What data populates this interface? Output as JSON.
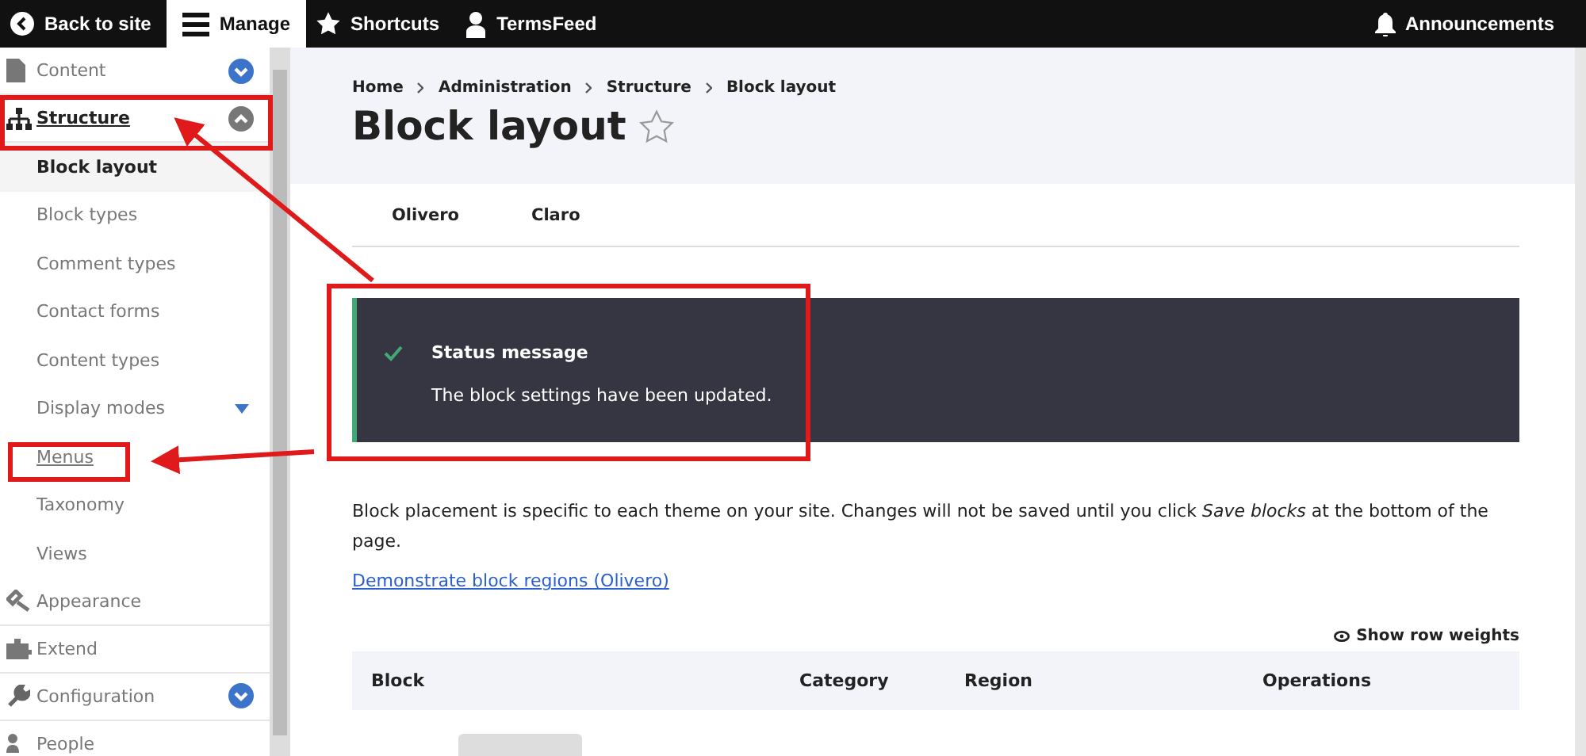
{
  "toolbar": {
    "items": [
      {
        "label": "Back to site",
        "selected": false
      },
      {
        "label": "Manage",
        "selected": true
      },
      {
        "label": "Shortcuts",
        "selected": false
      },
      {
        "label": "TermsFeed",
        "selected": false
      }
    ],
    "announcements": "Announcements"
  },
  "sidebar": {
    "items": [
      {
        "label": "Content",
        "expanded": false
      },
      {
        "label": "Structure",
        "expanded": true,
        "children": [
          {
            "label": "Block layout",
            "selected": true,
            "underlined": false
          },
          {
            "label": "Block types",
            "selected": false,
            "underlined": false
          },
          {
            "label": "Comment types",
            "selected": false,
            "underlined": false
          },
          {
            "label": "Contact forms",
            "selected": false,
            "underlined": false
          },
          {
            "label": "Content types",
            "selected": false,
            "underlined": false
          },
          {
            "label": "Display modes",
            "selected": false,
            "underlined": false,
            "expanded": false
          },
          {
            "label": "Menus",
            "selected": false,
            "underlined": true
          },
          {
            "label": "Taxonomy",
            "selected": false,
            "underlined": false
          },
          {
            "label": "Views",
            "selected": false,
            "underlined": false
          }
        ]
      },
      {
        "label": "Appearance"
      },
      {
        "label": "Extend"
      },
      {
        "label": "Configuration",
        "expanded": false
      },
      {
        "label": "People"
      }
    ]
  },
  "breadcrumb": [
    "Home",
    "Administration",
    "Structure",
    "Block layout"
  ],
  "title": "Block layout",
  "favorite": false,
  "theme_tabs": [
    {
      "label": "Olivero",
      "selected": false
    },
    {
      "label": "Claro",
      "selected": false
    }
  ],
  "status": {
    "title": "Status message",
    "text": "The block settings have been updated."
  },
  "description": "Block placement is specific to each theme on your site. Changes will not be saved until you click *Save blocks* at the bottom of the page.",
  "demo_link": "Demonstrate block regions (Olivero)",
  "show_weights": "Show row weights",
  "table": {
    "columns": [
      "Block",
      "Category",
      "Region",
      "Operations"
    ]
  }
}
